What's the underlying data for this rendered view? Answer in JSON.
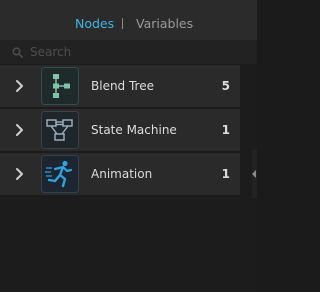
{
  "tabs": {
    "nodes": "Nodes",
    "variables": "Variables",
    "active": "Nodes"
  },
  "search": {
    "placeholder": "Search",
    "icon": "search-icon"
  },
  "nodes": [
    {
      "label": "Blend Tree",
      "count": "5",
      "icon": "blend-tree-icon"
    },
    {
      "label": "State Machine",
      "count": "1",
      "icon": "state-machine-icon"
    },
    {
      "label": "Animation",
      "count": "1",
      "icon": "animation-running-icon"
    }
  ],
  "colors": {
    "accent": "#3db6e6",
    "background": "#1c1c1c",
    "row": "#2a2a2a",
    "blend_tree_icon": "#7fc4a6",
    "state_machine_icon": "#9fb4c6",
    "animation_icon": "#2ea3e0"
  }
}
